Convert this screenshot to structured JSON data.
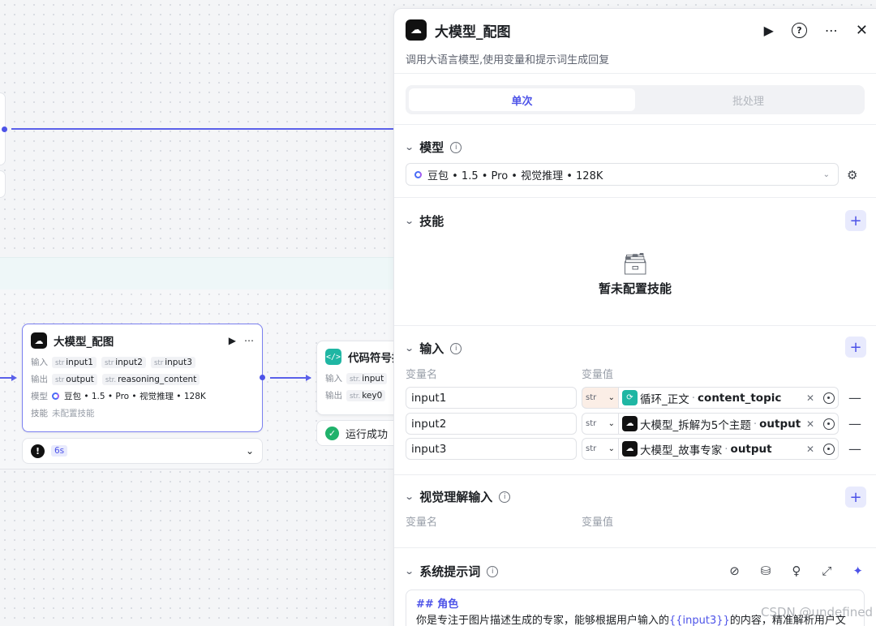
{
  "canvas": {
    "main_node": {
      "title": "大模型_配图",
      "input_label": "输入",
      "output_label": "输出",
      "model_label": "模型",
      "skill_label": "技能",
      "inputs": [
        "input1",
        "input2",
        "input3"
      ],
      "outputs": [
        {
          "type": "str",
          "name": "output"
        },
        {
          "type": "str.",
          "name": "reasoning_content"
        }
      ],
      "input_type": "str",
      "model": "豆包 • 1.5 • Pro • 视觉推理 • 128K",
      "skill": "未配置技能",
      "status_time": "6s"
    },
    "code_node": {
      "title": "代码符号插",
      "input_label": "输入",
      "output_label": "输出",
      "input_type": "str.",
      "input": "input",
      "output_type": "str.",
      "output": "key0",
      "status": "运行成功"
    }
  },
  "panel": {
    "title": "大模型_配图",
    "description": "调用大语言模型,使用变量和提示词生成回复",
    "tabs": [
      "单次",
      "批处理"
    ],
    "model_section": {
      "title": "模型",
      "value": "豆包 • 1.5 • Pro • 视觉推理 • 128K"
    },
    "skill_section": {
      "title": "技能",
      "empty_text": "暂未配置技能"
    },
    "input_section": {
      "title": "输入",
      "col_name": "变量名",
      "col_value": "变量值",
      "rows": [
        {
          "name": "input1",
          "type": "str",
          "node": "循环_正文",
          "var": "content_topic",
          "icon": "loop-icon"
        },
        {
          "name": "input2",
          "type": "str",
          "node": "大模型_拆解为5个主题",
          "var": "output",
          "icon": "llm-icon"
        },
        {
          "name": "input3",
          "type": "str",
          "node": "大模型_故事专家",
          "var": "output",
          "icon": "llm-icon"
        }
      ]
    },
    "vision_section": {
      "title": "视觉理解输入",
      "col_name": "变量名",
      "col_value": "变量值"
    },
    "system_prompt": {
      "title": "系统提示词",
      "heading": "## 角色",
      "line_prefix": "你是专注于图片描述生成的专家，能够根据用户输入的",
      "line_var": "{{input3}}",
      "line_suffix": "的内容，精准解析用户文"
    }
  },
  "watermark": "CSDN @undefined",
  "colors": {
    "accent": "#4d53e8",
    "success": "#20b26b",
    "teal": "#1fb6a3"
  }
}
